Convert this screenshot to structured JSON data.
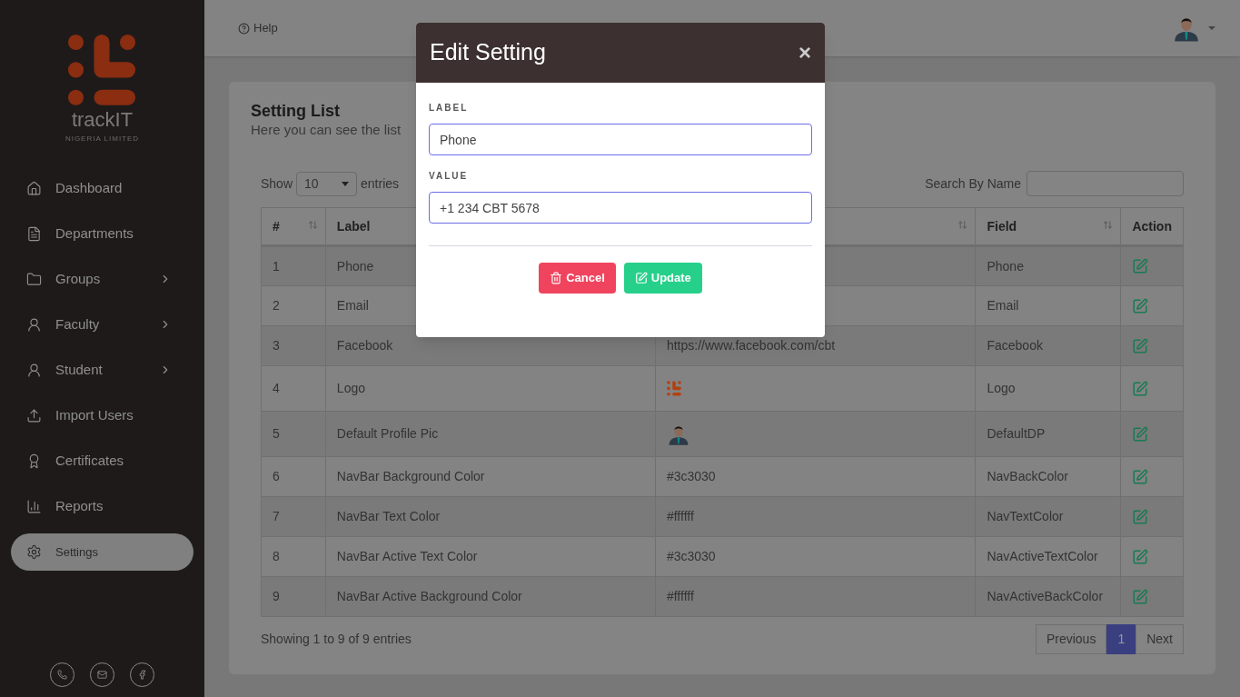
{
  "sidebar": {
    "logo": {
      "name": "trackIT",
      "tagline": "NIGERIA LIMITED"
    },
    "items": [
      {
        "label": "Dashboard",
        "selected": false,
        "submenu": false
      },
      {
        "label": "Departments",
        "selected": false,
        "submenu": false
      },
      {
        "label": "Groups",
        "selected": false,
        "submenu": true
      },
      {
        "label": "Faculty",
        "selected": false,
        "submenu": true
      },
      {
        "label": "Student",
        "selected": false,
        "submenu": true
      },
      {
        "label": "Import Users",
        "selected": false,
        "submenu": false
      },
      {
        "label": "Certificates",
        "selected": false,
        "submenu": false
      },
      {
        "label": "Reports",
        "selected": false,
        "submenu": false
      },
      {
        "label": "Settings",
        "selected": true,
        "submenu": false
      }
    ]
  },
  "topbar": {
    "help": "Help"
  },
  "card": {
    "title": "Setting List",
    "subtitle": "Here you can see the list",
    "show_label": "Show",
    "page_size": "10",
    "entries_label": "entries",
    "search_label": "Search By Name",
    "columns": [
      {
        "label": "#",
        "sortable": true
      },
      {
        "label": "Label"
      },
      {
        "sortable": true
      },
      {
        "label": "Field",
        "sortable": true
      },
      {
        "label": "Action",
        "sortable": false
      }
    ],
    "rows": [
      {
        "num": "1",
        "label": "Phone",
        "field": "Phone"
      },
      {
        "num": "2",
        "label": "Email",
        "field": "Email"
      },
      {
        "num": "3",
        "label": "Facebook",
        "kind": "text",
        "value": "https://www.facebook.com/cbt",
        "field": "Facebook"
      },
      {
        "num": "4",
        "label": "Logo",
        "kind": "logo",
        "field": "Logo"
      },
      {
        "num": "5",
        "label": "Default Profile Pic",
        "kind": "avatar",
        "field": "DefaultDP"
      },
      {
        "num": "6",
        "label": "NavBar Background Color",
        "kind": "text",
        "value": "#3c3030",
        "field": "NavBackColor"
      },
      {
        "num": "7",
        "label": "NavBar Text Color",
        "kind": "text",
        "value": "#ffffff",
        "field": "NavTextColor"
      },
      {
        "num": "8",
        "label": "NavBar Active Text Color",
        "kind": "text",
        "value": "#3c3030",
        "field": "NavActiveTextColor"
      },
      {
        "num": "9",
        "label": "NavBar Active Background Color",
        "kind": "text",
        "value": "#ffffff",
        "field": "NavActiveBackColor"
      }
    ],
    "info": "Showing 1 to 9 of 9 entries",
    "pagination": [
      {
        "label": "Previous",
        "selected": false
      },
      {
        "label": "1",
        "selected": true
      },
      {
        "label": "Next",
        "selected": false
      }
    ]
  },
  "modal": {
    "title": "Edit Setting",
    "close": "×",
    "fields": [
      {
        "label": "LABEL",
        "value": "Phone"
      },
      {
        "label": "VALUE",
        "value": "+1 234 CBT 5678"
      }
    ],
    "buttons": [
      {
        "label": "Cancel",
        "kind": "cancel"
      },
      {
        "label": "Update",
        "kind": "update"
      }
    ]
  }
}
